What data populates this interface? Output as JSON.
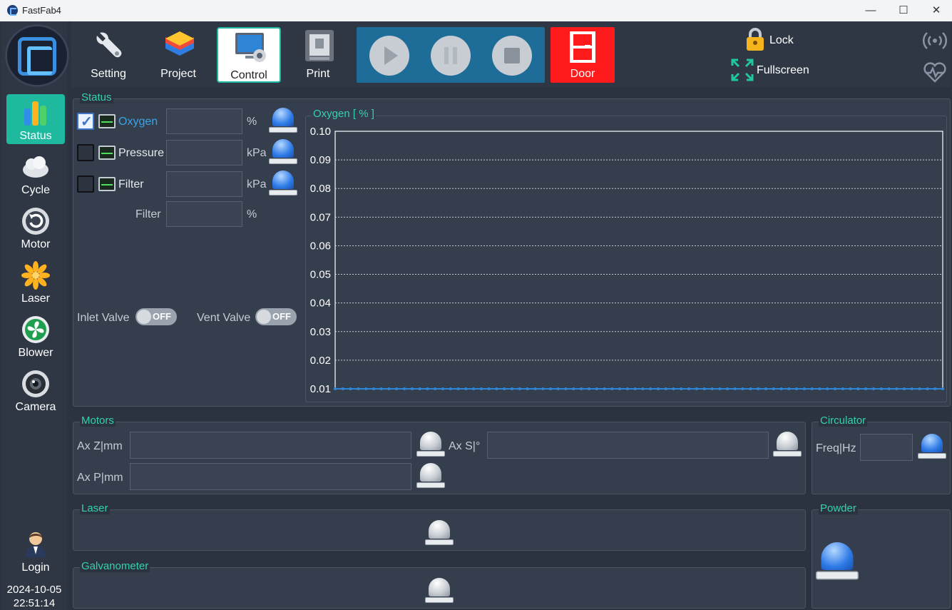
{
  "window": {
    "title": "FastFab4",
    "min": "—",
    "max": "☐",
    "close": "✕"
  },
  "sidebar": {
    "items": [
      {
        "label": "Status",
        "icon": "bar-chart-icon"
      },
      {
        "label": "Cycle",
        "icon": "cloud-icon"
      },
      {
        "label": "Motor",
        "icon": "motor-icon"
      },
      {
        "label": "Laser",
        "icon": "laser-icon"
      },
      {
        "label": "Blower",
        "icon": "fan-icon"
      },
      {
        "label": "Camera",
        "icon": "camera-icon"
      },
      {
        "label": "Login",
        "icon": "user-icon"
      }
    ],
    "date": "2024-10-05",
    "time": "22:51:14"
  },
  "toolbar": {
    "items": [
      {
        "label": "Setting",
        "icon": "wrench-icon"
      },
      {
        "label": "Project",
        "icon": "layers-icon"
      },
      {
        "label": "Control",
        "icon": "control-icon"
      },
      {
        "label": "Print",
        "icon": "printer-icon"
      }
    ],
    "door_label": "Door",
    "lock_label": "Lock",
    "fullscreen_label": "Fullscreen"
  },
  "status": {
    "title": "Status",
    "rows": [
      {
        "label": "Oxygen",
        "unit": "%",
        "checked": true
      },
      {
        "label": "Pressure",
        "unit": "kPa",
        "checked": false
      },
      {
        "label": "Filter",
        "unit": "kPa",
        "checked": false
      }
    ],
    "filter2": {
      "label": "Filter",
      "unit": "%"
    },
    "inlet": {
      "label": "Inlet Valve",
      "state": "OFF"
    },
    "vent": {
      "label": "Vent Valve",
      "state": "OFF"
    }
  },
  "chart_data": {
    "type": "line",
    "title": "Oxygen [ % ]",
    "ylim": [
      0.01,
      0.1
    ],
    "yticks": [
      "0.10",
      "0.09",
      "0.08",
      "0.07",
      "0.06",
      "0.05",
      "0.04",
      "0.03",
      "0.02",
      "0.01"
    ],
    "series": [
      {
        "values": [
          0.01,
          0.01,
          0.01,
          0.01,
          0.01,
          0.01,
          0.01,
          0.01,
          0.01,
          0.01,
          0.01,
          0.01,
          0.01,
          0.01,
          0.01,
          0.01,
          0.01,
          0.01,
          0.01,
          0.01,
          0.01,
          0.01,
          0.01,
          0.01,
          0.01,
          0.01,
          0.01,
          0.01,
          0.01,
          0.01,
          0.01,
          0.01,
          0.01,
          0.01,
          0.01,
          0.01,
          0.01,
          0.01,
          0.01,
          0.01,
          0.01,
          0.01,
          0.01,
          0.01,
          0.01,
          0.01,
          0.01,
          0.01,
          0.01,
          0.01,
          0.01,
          0.01,
          0.01,
          0.01,
          0.01,
          0.01,
          0.01,
          0.01,
          0.01,
          0.01,
          0.01,
          0.01,
          0.01,
          0.01,
          0.01,
          0.01,
          0.01,
          0.01,
          0.01,
          0.01,
          0.01,
          0.01,
          0.01,
          0.01,
          0.01,
          0.01,
          0.01,
          0.01,
          0.01,
          0.01
        ],
        "color": "#2f86d6"
      }
    ],
    "grid": true
  },
  "motors": {
    "title": "Motors",
    "axz": "Ax Z|mm",
    "axs": "Ax S|°",
    "axp": "Ax P|mm"
  },
  "circulator": {
    "title": "Circulator",
    "freq": "Freq|Hz"
  },
  "laser": {
    "title": "Laser"
  },
  "powder": {
    "title": "Powder"
  },
  "galvo": {
    "title": "Galvanometer"
  },
  "colors": {
    "accent": "#1fb9a0",
    "door": "#ff1b1b",
    "play_bar": "#1e6c98",
    "series": "#2f86d6"
  }
}
